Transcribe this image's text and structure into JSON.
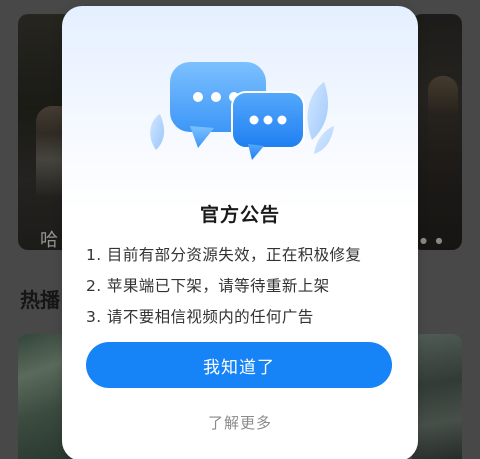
{
  "background": {
    "card_caption": "哈",
    "section_title": "热播"
  },
  "dialog": {
    "illustration_icon": "chat-bubbles-icon",
    "title": "官方公告",
    "notices": [
      "1. 目前有部分资源失效，正在积极修复",
      "2. 苹果端已下架，请等待重新上架",
      "3. 请不要相信视频内的任何广告"
    ],
    "confirm_label": "我知道了",
    "more_label": "了解更多"
  },
  "colors": {
    "accent": "#1683f6",
    "bubble_light": "#4ba3fb",
    "bubble_dark": "#2b86f5"
  }
}
